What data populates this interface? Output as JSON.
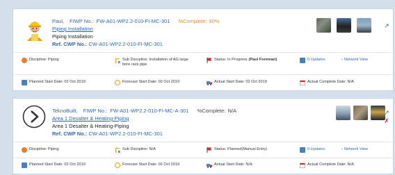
{
  "cards": [
    {
      "name": "Paul,",
      "fiwp_label": "FIWP No.:",
      "fiwp_value": "FW-A01-WP2.2-010-FI-MC-301",
      "complete_label": "%Complete:",
      "complete_value": "90%",
      "link_title": "Piping Installation",
      "description": "Piping Installation",
      "ref_label": "Ref. CWP No.:",
      "ref_value": "CW-A01-WP2.2-010-FI-MC-301",
      "discipline": "Discipline: Piping",
      "sub_discipline": "Sub Discipline: Installation of AG large bore rack pipe",
      "status_label": "Status: In Progress",
      "status_extra": "(Paul Foreman)",
      "updates": "0 Updates",
      "network": "Network View",
      "planned_start": "Planned Start Date: 02 Oct 2019",
      "forecast_start": "Forecast Start Date: 02 Oct 2019",
      "actual_start": "Actual Start Date: 02 Oct 2019",
      "actual_complete": "Actual Complete Date: N/A"
    },
    {
      "name": "TeknoBuilt,",
      "fiwp_label": "FIWP No.:",
      "fiwp_value": "FW-A01-WP2.2-010-FI-MC-A-301",
      "complete_label": "%Complete:",
      "complete_value": "N/A",
      "link_title": "Area 1 Desalter & Heating-Piping",
      "description": "Area 1 Desalter & Heating-Piping",
      "ref_label": "Ref. CWP No.:",
      "ref_value": "CW-A01-WP2.2-010-FI-MC-301",
      "discipline": "Discipline: Piping",
      "sub_discipline": "Sub Discipline: N/A",
      "status_label": "Status: Planned(Manual Entry)",
      "updates": "0 Updates",
      "network": "Network View",
      "planned_start": "Planned Start Date: 02 Oct 2019",
      "forecast_start": "Forecast Start Date: 02 Oct 2019",
      "actual_start": "Actual Start Date: N/A",
      "actual_complete": "Actual Complete Date: N/A"
    }
  ],
  "icons": {
    "avatar1": "worker-hardhat-avatar",
    "avatar2": "chevron-right-circle-icon",
    "discipline": "discipline-badge-icon",
    "sub_discipline": "crane-icon",
    "status": "flag-icon",
    "updates": "updates-icon",
    "network": "network-share-icon",
    "planned": "calendar-icon",
    "forecast": "clock-icon",
    "actual_start": "truck-icon",
    "actual_complete": "calendar-check-icon",
    "pin": "pin-icon",
    "delete": "delete-x-icon"
  },
  "colors": {
    "accent": "#2f67a8",
    "orange": "#e78b1e",
    "red": "#d8262b",
    "background": "#d3e0ec"
  }
}
